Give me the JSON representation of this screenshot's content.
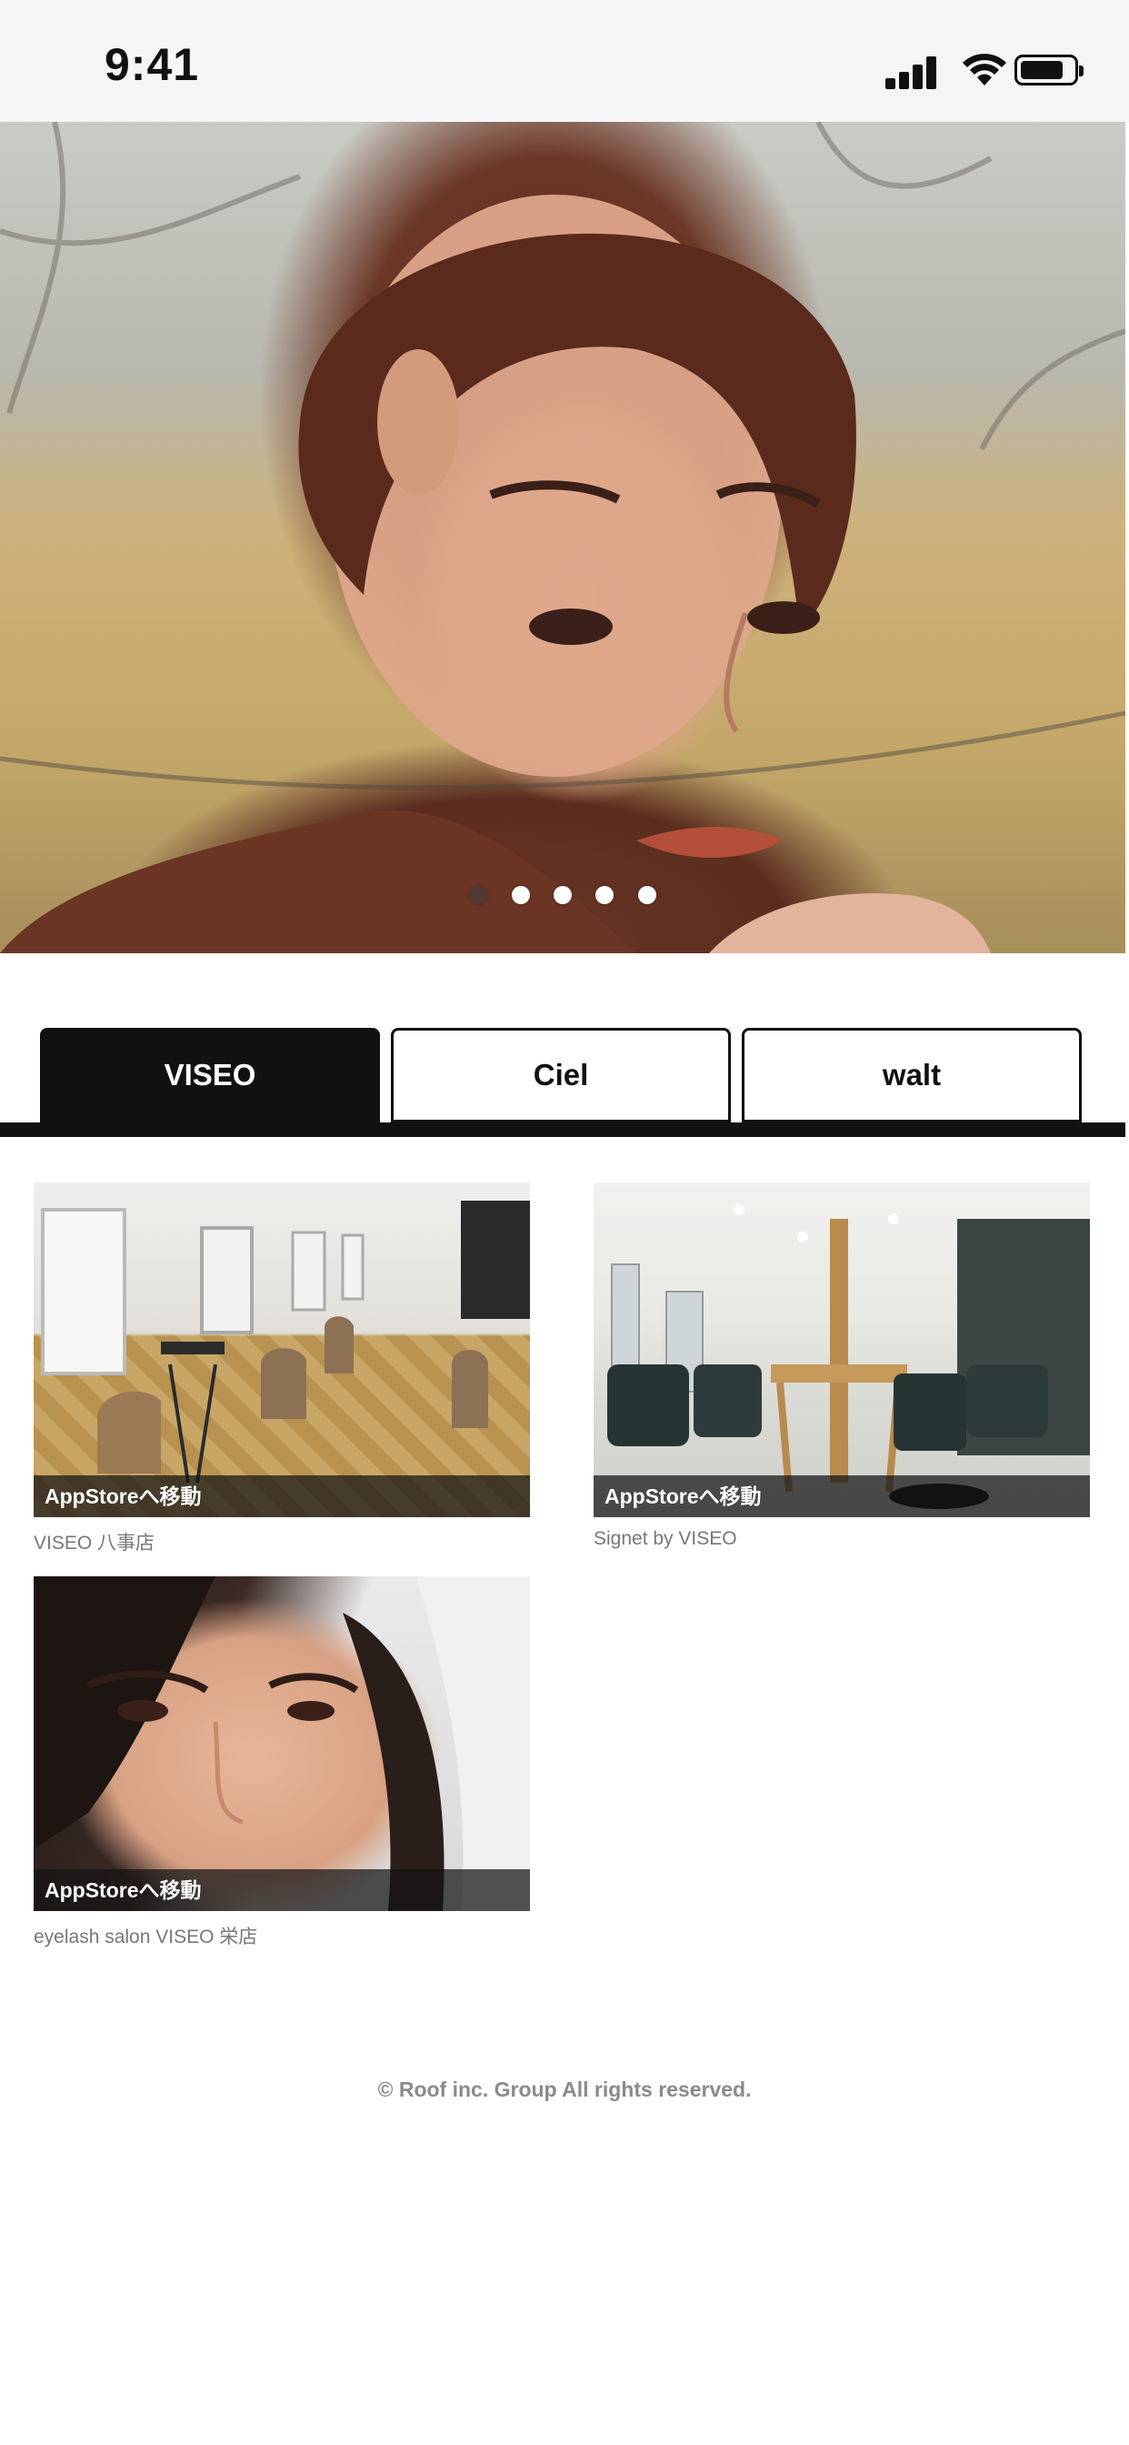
{
  "status_bar": {
    "time": "9:41"
  },
  "hero": {
    "dots_count": 5,
    "active_dot": 0
  },
  "tabs": [
    {
      "label": "VISEO",
      "active": true
    },
    {
      "label": "Ciel",
      "active": false
    },
    {
      "label": "walt",
      "active": false
    }
  ],
  "cards": [
    {
      "overlay": "AppStoreへ移動",
      "caption": "VISEO 八事店"
    },
    {
      "overlay": "AppStoreへ移動",
      "caption": "Signet by VISEO"
    },
    {
      "overlay": "AppStoreへ移動",
      "caption": "eyelash salon VISEO 栄店"
    }
  ],
  "footer": {
    "copyright": "© Roof inc. Group All rights reserved."
  },
  "colors": {
    "tab_active_bg": "#111111",
    "overlay_bg": "#141414",
    "caption": "#777777"
  }
}
